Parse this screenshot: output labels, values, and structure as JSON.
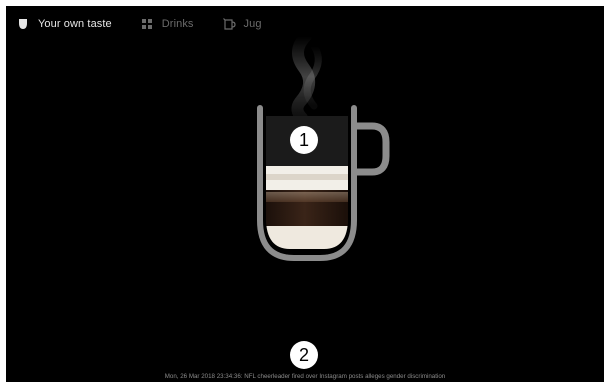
{
  "tabs": [
    {
      "label": "Your own taste",
      "icon": "cup-icon",
      "active": true
    },
    {
      "label": "Drinks",
      "icon": "grid-icon",
      "active": false
    },
    {
      "label": "Jug",
      "icon": "jug-icon",
      "active": false
    }
  ],
  "markers": {
    "one": "1",
    "two": "2"
  },
  "ticker": {
    "datetime": "Mon, 26 Mar 2018 23:34:36:",
    "headline": "NFL cheerleader fired over Instagram posts alleges gender discrimination"
  },
  "colors": {
    "background": "#000000",
    "active_tab": "#e6e6e6",
    "inactive_tab": "#6b6b6b",
    "cup_outline": "#8c8c8c",
    "espresso": "#2a1a12",
    "milk_foam": "#f2efe8"
  }
}
